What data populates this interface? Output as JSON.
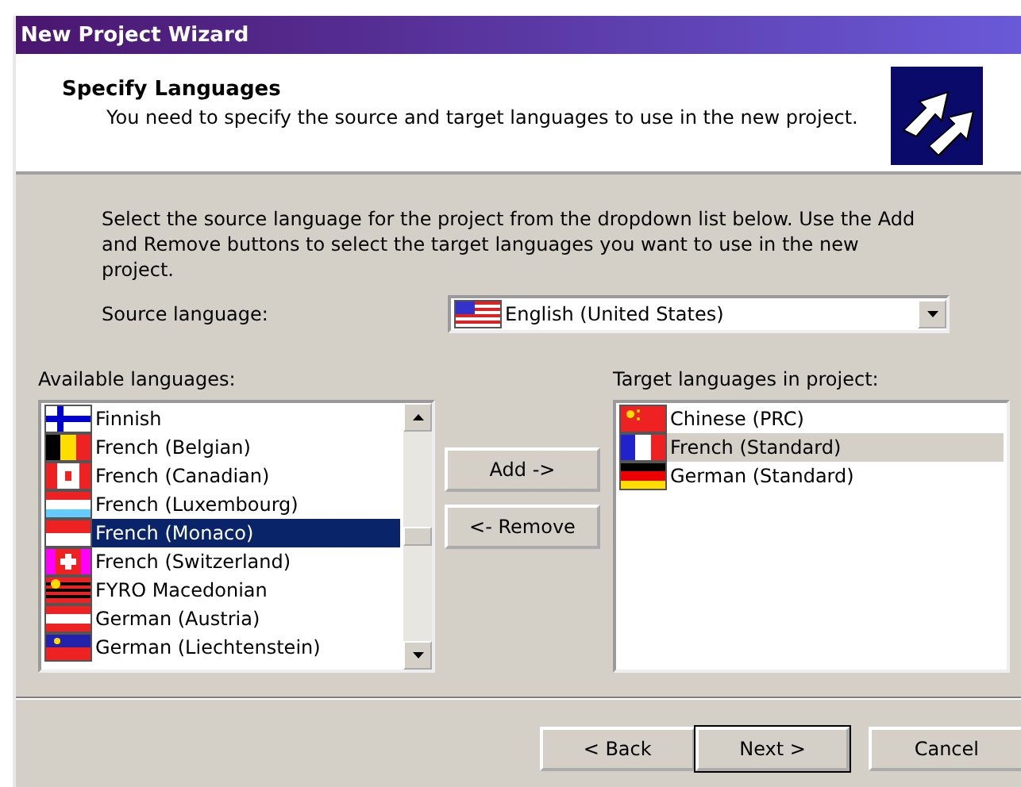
{
  "window": {
    "title": "New Project Wizard"
  },
  "header": {
    "title": "Specify Languages",
    "subtitle": "You need to specify the source and target languages to use in the new project."
  },
  "instructions": "Select the source language for the project from the dropdown list below. Use the Add and Remove buttons to select the target languages you want to use in the new project.",
  "source": {
    "label": "Source language:",
    "value": "English (United States)",
    "kind": "usa"
  },
  "available": {
    "label": "Available languages:",
    "items": [
      {
        "label": "Finnish",
        "kind": "finland",
        "selected": false
      },
      {
        "label": "French (Belgian)",
        "kind": "belgium",
        "selected": false
      },
      {
        "label": "French (Canadian)",
        "kind": "canada",
        "selected": false
      },
      {
        "label": "French (Luxembourg)",
        "kind": "luxembourg",
        "selected": false
      },
      {
        "label": "French (Monaco)",
        "kind": "monaco",
        "selected": true
      },
      {
        "label": "French (Switzerland)",
        "kind": "switzerland",
        "selected": false
      },
      {
        "label": "FYRO Macedonian",
        "kind": "macedonia",
        "selected": false
      },
      {
        "label": "German (Austria)",
        "kind": "austria",
        "selected": false
      },
      {
        "label": "German (Liechtenstein)",
        "kind": "liechtenstein",
        "selected": false
      }
    ]
  },
  "actions": [
    "Add ->",
    "<- Remove"
  ],
  "target": {
    "label": "Target languages in project:",
    "items": [
      {
        "label": "Chinese (PRC)",
        "kind": "china",
        "selected": false
      },
      {
        "label": "French (Standard)",
        "kind": "france",
        "selected": true
      },
      {
        "label": "German (Standard)",
        "kind": "germany",
        "selected": false
      }
    ]
  },
  "buttons": [
    {
      "label": "< Back",
      "default": false
    },
    {
      "label": "Next >",
      "default": true
    },
    {
      "label": "Cancel",
      "default": false
    }
  ]
}
